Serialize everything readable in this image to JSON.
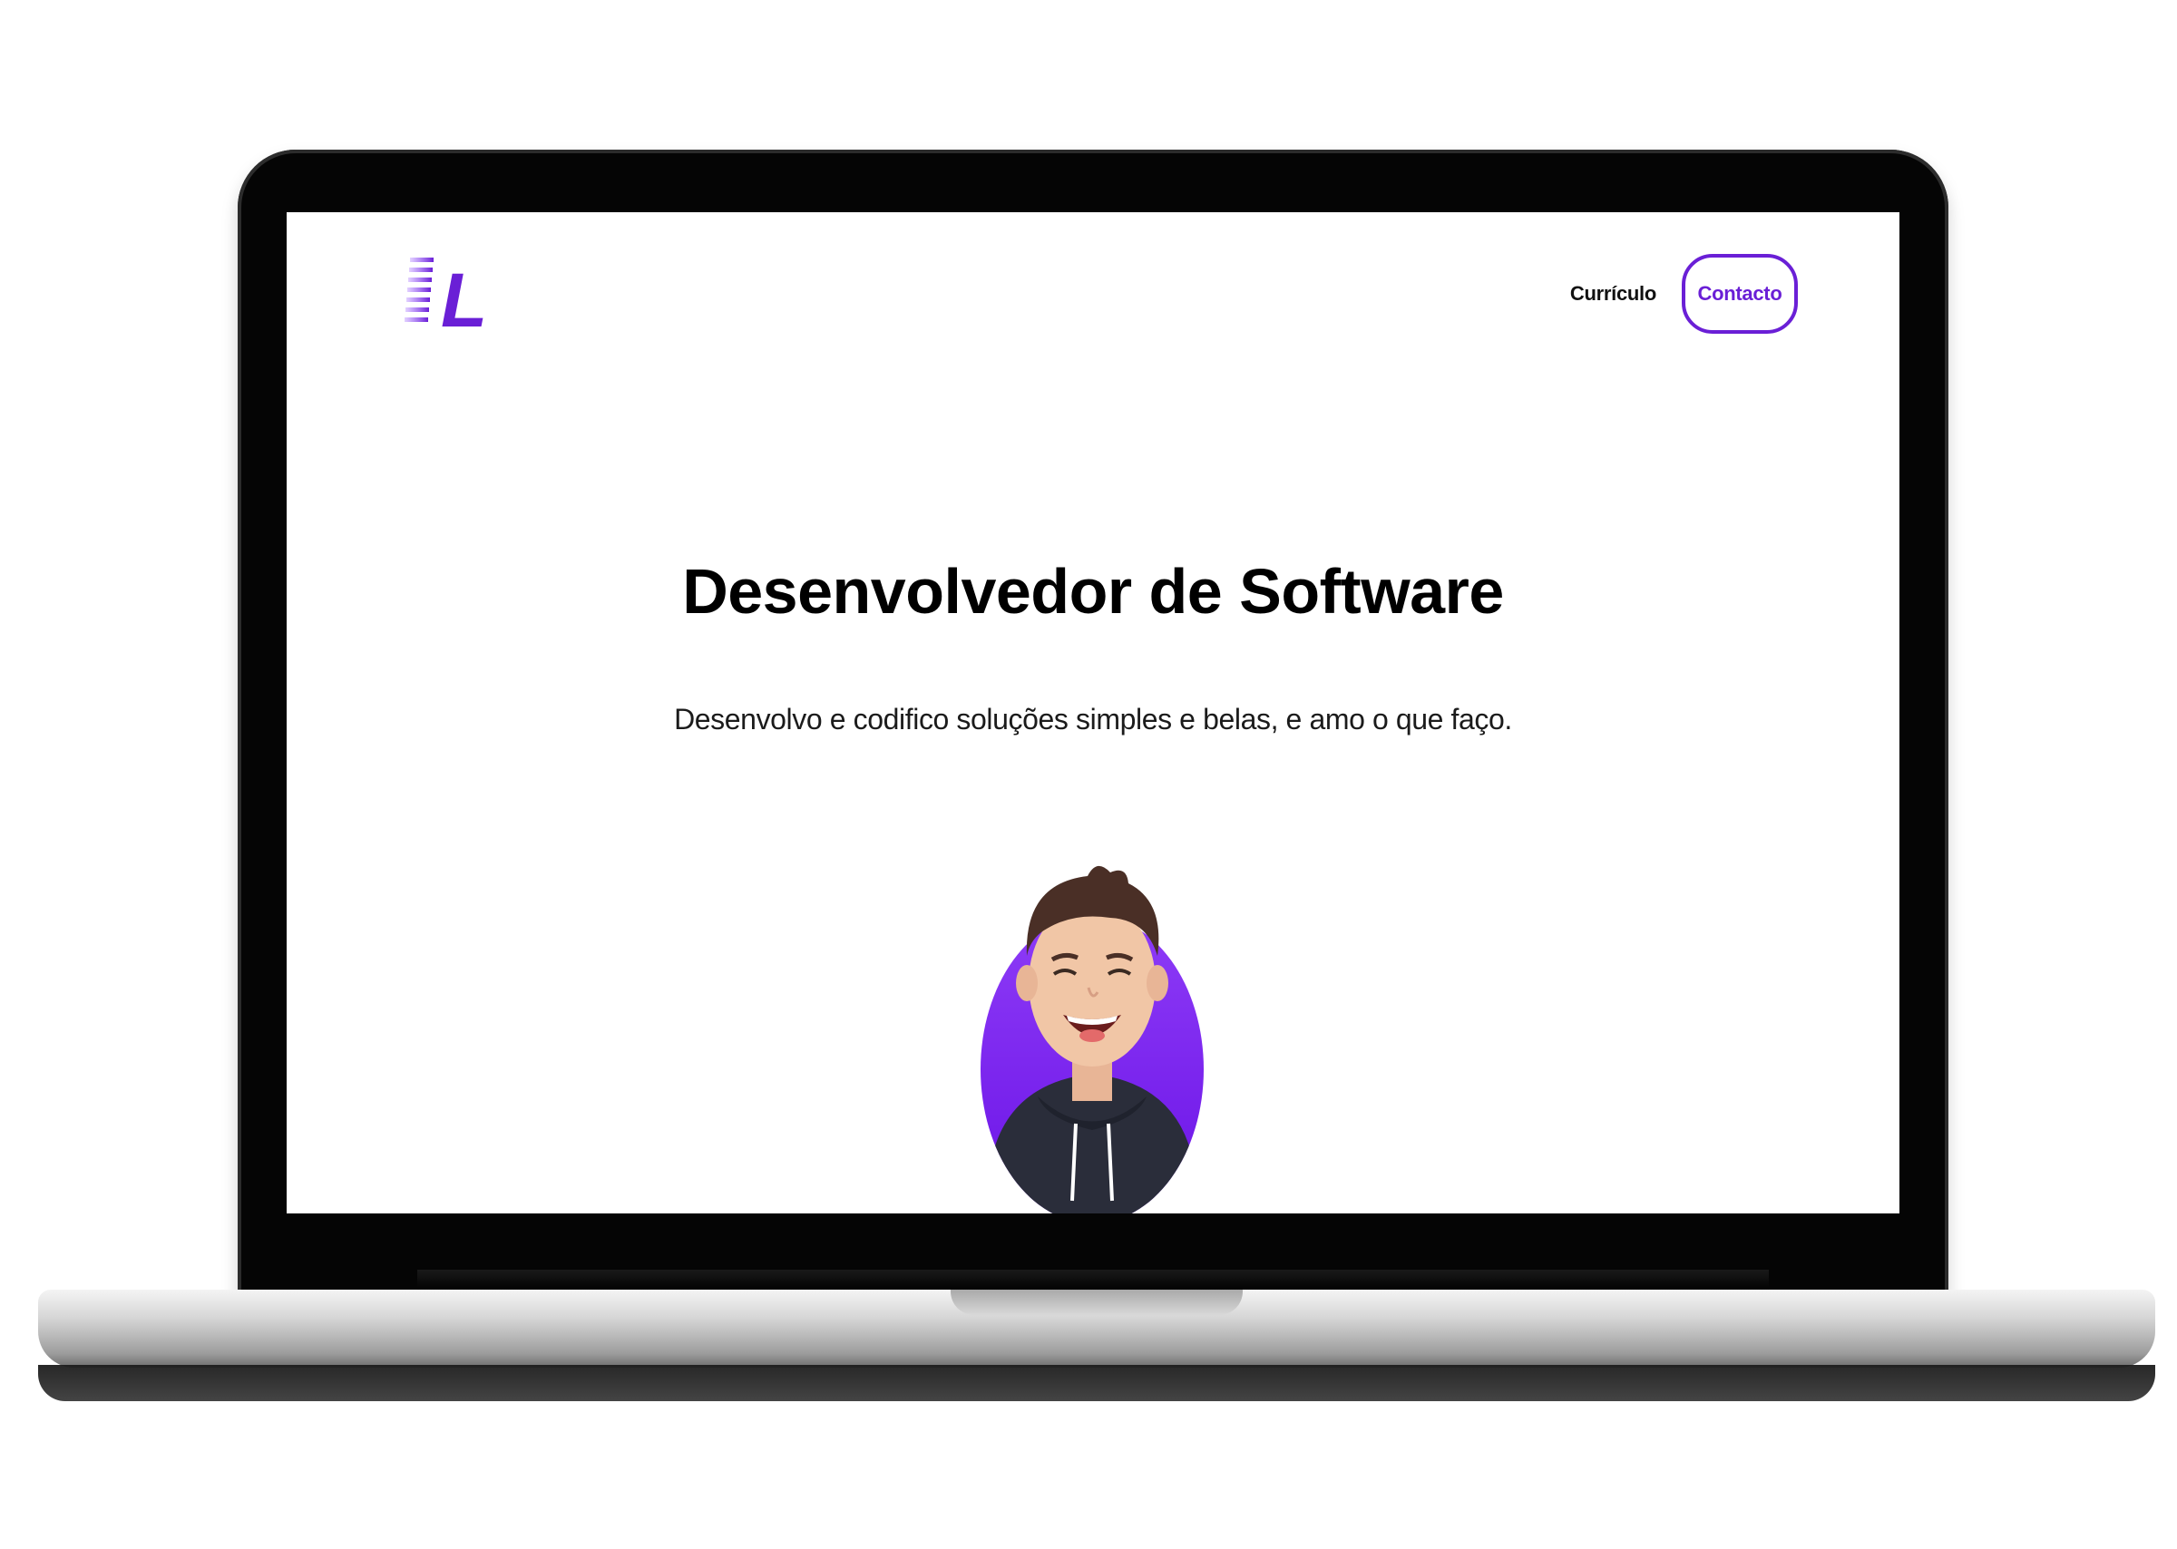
{
  "header": {
    "logo_letter": "L",
    "nav": {
      "curriculo_label": "Currículo",
      "contacto_label": "Contacto"
    }
  },
  "hero": {
    "title": "Desenvolvedor de Software",
    "subtitle": "Desenvolvo e codifico soluções simples e belas, e amo o que faço."
  },
  "colors": {
    "accent": "#6a1fd6",
    "text": "#000000",
    "background": "#ffffff"
  },
  "icons": {
    "logo": "speed-lines-L-logo",
    "avatar": "cartoon-avatar"
  }
}
